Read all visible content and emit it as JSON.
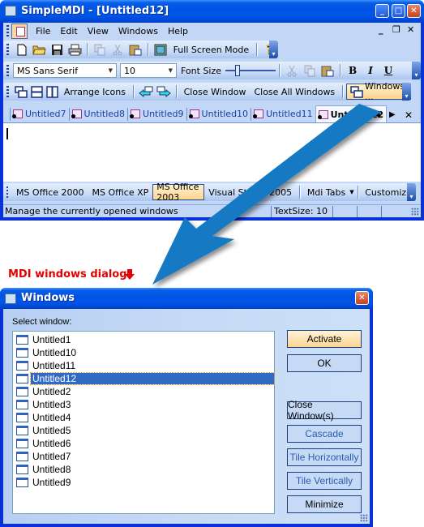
{
  "app": {
    "title": "SimpleMDI - [Untitled12]",
    "caption_buttons": {
      "minimize": "_",
      "maximize": "□",
      "close": "✕"
    },
    "menu": {
      "items": [
        "File",
        "Edit",
        "View",
        "Windows",
        "Help"
      ],
      "mdi_controls": {
        "minimize": "_",
        "restore": "❐",
        "close": "✕"
      }
    },
    "standard_toolbar": {
      "icons": [
        "new-document-icon",
        "open-folder-icon",
        "save-icon",
        "print-icon",
        "copy-icon",
        "cut-icon",
        "paste-icon"
      ],
      "full_screen_label": "Full Screen Mode",
      "help_glyph": "?"
    },
    "format_toolbar": {
      "font_name": "MS Sans Serif",
      "font_size": "10",
      "font_size_label": "Font Size",
      "font_size_slider_value": 0.2,
      "bold": "B",
      "italic": "I",
      "underline": "U"
    },
    "window_toolbar": {
      "arrange_icons_label": "Arrange Icons",
      "close_window_label": "Close Window",
      "close_all_label": "Close All Windows",
      "windows_label": "Windows ..."
    },
    "tabs": [
      {
        "label": "Untitled7",
        "active": false
      },
      {
        "label": "Untitled8",
        "active": false
      },
      {
        "label": "Untitled9",
        "active": false
      },
      {
        "label": "Untitled10",
        "active": false
      },
      {
        "label": "Untitled11",
        "active": false
      },
      {
        "label": "Untitled12",
        "active": true
      }
    ],
    "tab_nav": {
      "prev": "◀",
      "next": "▶",
      "close": "✕"
    },
    "style_toolbar": {
      "items": [
        "MS Office 2000",
        "MS Office XP",
        "MS Office 2003",
        "Visual Studio 2005"
      ],
      "selected": "MS Office 2003",
      "mdi_tabs_label": "Mdi Tabs",
      "customize_label": "Customize"
    },
    "status": {
      "message": "Manage the currently opened windows",
      "text_size": "TextSize: 10"
    }
  },
  "annotation": {
    "label": "MDI windows dialog",
    "arrow": "🡇"
  },
  "dialog": {
    "title": "Windows",
    "select_label": "Select window:",
    "windows": [
      "Untitled1",
      "Untitled10",
      "Untitled11",
      "Untitled12",
      "Untitled2",
      "Untitled3",
      "Untitled4",
      "Untitled5",
      "Untitled6",
      "Untitled7",
      "Untitled8",
      "Untitled9"
    ],
    "selected_window": "Untitled12",
    "buttons": {
      "activate": "Activate",
      "ok": "OK",
      "close_windows": "Close Window(s)",
      "cascade": "Cascade",
      "tile_horizontally": "Tile Horizontally",
      "tile_vertically": "Tile Vertically",
      "minimize": "Minimize"
    },
    "close_glyph": "✕"
  },
  "colors": {
    "xp_title_blue": "#0054e3",
    "toolbar_highlight": "#fdd38f",
    "selection": "#316ac5",
    "annotation_red": "#e20000",
    "overlay_arrow": "#1479c4"
  }
}
